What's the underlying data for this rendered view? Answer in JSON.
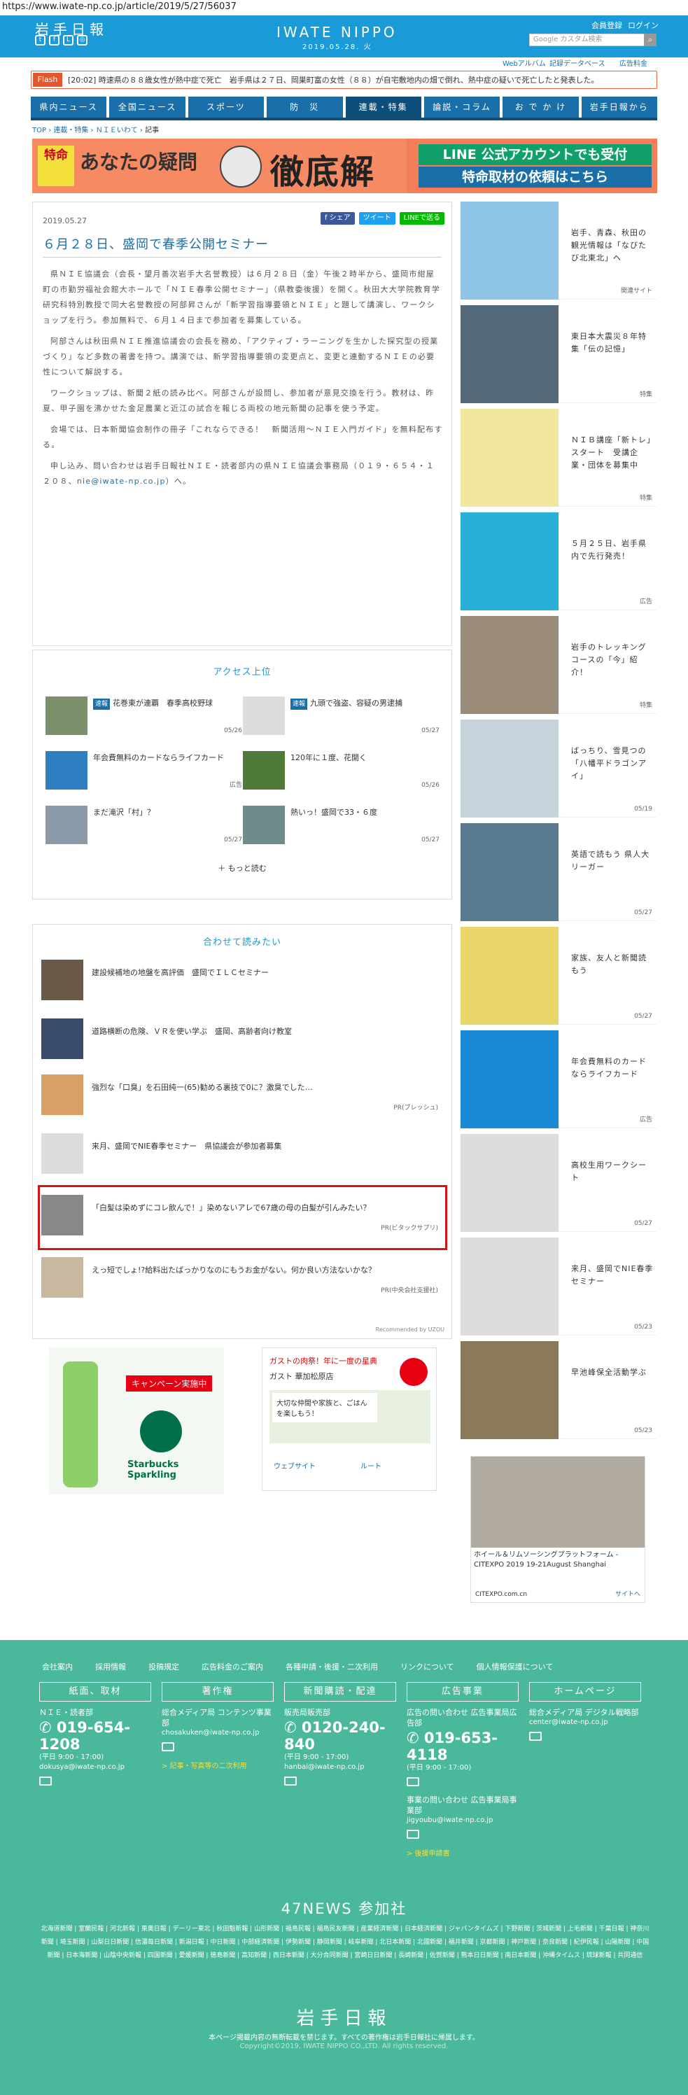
{
  "url": "https://www.iwate-np.co.jp/article/2019/5/27/56037",
  "header": {
    "logo_jp": "岩手日報",
    "brand": "IWATE NIPPO",
    "date": "2019.05.28. 火",
    "register": "会員登録",
    "login": "ログイン",
    "search_placeholder": "Google カスタム検索"
  },
  "sublinks": [
    "Webアルバム",
    "記録データベース",
    "広告料金"
  ],
  "flash": {
    "tag": "Flash",
    "text": "[20:02] 時速県の８８歳女性が熱中症で死亡　岩手県は２７日、岡巣町富の女性（８８）が自宅敷地内の畑で倒れ、熱中症の疑いで死亡したと発表した。"
  },
  "nav": [
    "県内ニュース",
    "全国ニュース",
    "スポーツ",
    "防　災",
    "連載・特集",
    "論説・コラム",
    "お で か け",
    "岩手日報から"
  ],
  "breadcrumb": [
    "TOP",
    "連載・特集",
    "ＮＩＥいわて",
    "記事"
  ],
  "banner": {
    "tokudo": "特命",
    "question": "あなたの疑問",
    "big": "徹底解明",
    "line1": "LINE 公式アカウントでも受付",
    "line2": "特命取材の依頼はこちら"
  },
  "article": {
    "date": "2019.05.27",
    "share": [
      "f シェア",
      "ツイート",
      "LINEで送る"
    ],
    "title": "６月２８日、盛岡で春季公開セミナー",
    "paragraphs": [
      "県ＮＩＥ協議会（会長・望月善次岩手大名誉教授）は６月２８日（金）午後２時半から、盛岡市紺屋町の市勤労福祉会館大ホールで「ＮＩＥ春季公開セミナー」（県教委後援）を開く。秋田大大学院教育学研究科特別教授で同大名誉教授の阿部昇さんが「新学習指導要領とＮＩＥ」と題して講演し、ワークショップを行う。参加無料で、６月１４日まで参加者を募集している。",
      "阿部さんは秋田県ＮＩＥ推進協議会の会長を務め、「アクティブ・ラーニングを生かした探究型の授業づくり」など多数の著書を持つ。講演では、新学習指導要領の変更点と、変更と連動するＮＩＥの必要性について解説する。",
      "ワークショップは、新聞２紙の読み比べ。阿部さんが設問し、参加者が意見交換を行う。教材は、昨夏、甲子園を沸かせた金足農業と近江の試合を報じる両校の地元新聞の記事を使う予定。",
      "会場では、日本新聞協会制作の冊子「これならできる！　新聞活用～ＮＩＥ入門ガイド」を無料配布する。"
    ],
    "contact": "申し込み、問い合わせは岩手日報社ＮＩＥ・読者部内の県ＮＩＥ協議会事務局（０１９・６５４・１２０８、",
    "email": "nie@iwate-np.co.jp",
    "contact_end": "）へ。"
  },
  "access": {
    "title": "アクセス上位",
    "items": [
      {
        "tag": "速報",
        "text": "花巻東が連覇　春季高校野球",
        "date": "05/26"
      },
      {
        "tag": "速報",
        "text": "九頭で強盗、容疑の男逮捕",
        "date": "05/27"
      },
      {
        "tag": "",
        "text": "年会費無料のカードならライフカード",
        "date": "広告"
      },
      {
        "tag": "",
        "text": "120年に１度、花開く",
        "date": "05/26"
      },
      {
        "tag": "",
        "text": "まだ滝沢「村」？",
        "date": "05/27"
      },
      {
        "tag": "",
        "text": "熱いっ！盛岡で33・６度",
        "date": "05/27"
      }
    ],
    "more": "もっと読む"
  },
  "related": {
    "title": "合わせて読みたい",
    "items": [
      {
        "text": "建設候補地の地盤を高評価　盛岡でＩＬＣセミナー",
        "pr": ""
      },
      {
        "text": "道路横断の危険、ＶＲを使い学ぶ　盛岡、高齢者向け教室",
        "pr": ""
      },
      {
        "text": "強烈な「口臭」を石田純一(65)勧める裏技で0に？激臭でした…",
        "pr": "PR(ブレッシュ)"
      },
      {
        "text": "来月、盛岡でNIE春季セミナー　県協議会が参加者募集",
        "pr": ""
      },
      {
        "text": "「白髪は染めずにコレ飲んで！」染めないアレで67歳の母の白髪が引んみたい？",
        "pr": "PR(ビタックサプリ)"
      },
      {
        "text": "えっ短でしょ!?給料出たばっかりなのにもうお金がない。何か良い方法ないかな？",
        "pr": "PR(中央会社支援社)"
      }
    ],
    "recommended": "Recommended by UZOU"
  },
  "ads": {
    "ad1_text": "キャンペーン実施中",
    "ad1_brand": "Starbucks Sparkling",
    "ad2_title": "ガストの肉祭！年に一度の星典",
    "ad2_sub": "ガスト 華加松原店",
    "ad2_body": "大切な仲間や家族と、ごはんを楽しもう！",
    "ad2_web": "ウェブサイト",
    "ad2_route": "ルート"
  },
  "side": [
    {
      "text": "岩手、青森、秋田の観光情報は「なびたび北東北」へ",
      "meta": "関連サイト"
    },
    {
      "text": "東日本大震災８年特集「伝の記憶」",
      "meta": "特集"
    },
    {
      "text": "ＮＩＢ講座「新トレ」スタート　受講企業・団体を募集中",
      "meta": "特集"
    },
    {
      "text": "５月２５日、岩手県内で先行発売！",
      "meta": "広告"
    },
    {
      "text": "岩手のトレッキングコースの「今」紹介！",
      "meta": "特集"
    },
    {
      "text": "ばっちり、雪見つの「八幡平ドラゴンアイ」",
      "meta": "05/19"
    },
    {
      "text": "英語で読もう 県人大リーガー",
      "meta": "05/27"
    },
    {
      "text": "家族、友人と新聞読もう",
      "meta": "05/27"
    },
    {
      "text": "年会費無料のカードならライフカード",
      "meta": "広告"
    },
    {
      "text": "高校生用ワークシート",
      "meta": "05/27"
    },
    {
      "text": "来月、盛岡でNIE春季セミナー",
      "meta": "05/23"
    },
    {
      "text": "早池峰保全活動学ぶ",
      "meta": "05/23"
    }
  ],
  "side_ad": {
    "text": "ホイール＆リムソーシングプラットフォーム -CITEXPO 2019 19-21August Shanghai",
    "brand": "CITEXPO.com.cn",
    "link": "サイトへ"
  },
  "footer": {
    "links": [
      "会社案内",
      "採用情報",
      "投稿規定",
      "広告料金のご案内",
      "各種申請・後援・二次利用",
      "リンクについて",
      "個人情報保護について"
    ],
    "cols": [
      {
        "head": "紙面、取材",
        "sub": "ＮＩＥ・読者部",
        "tel": "019-654-1208",
        "hours": "(平日 9:00 - 17:00)",
        "mail": "dokusya@iwate-np.co.jp",
        "extra": ""
      },
      {
        "head": "著作権",
        "sub": "総合メディア局 コンテンツ事業部",
        "tel": "",
        "hours": "",
        "mail": "chosakuken@iwate-np.co.jp",
        "extra": "> 記事・写真等の二次利用"
      },
      {
        "head": "新聞購読・配達",
        "sub": "販売局販売部",
        "tel": "0120-240-840",
        "hours": "(平日 9:00 - 17:00)",
        "mail": "hanbai@iwate-np.co.jp",
        "extra": ""
      },
      {
        "head": "広告事業",
        "sub": "広告の問い合わせ 広告事業局広告部",
        "tel": "019-653-4118",
        "hours": "(平日 9:00 - 17:00)",
        "mail": "jigyoubu@iwate-np.co.jp",
        "extra": "> 後援申請書",
        "sub2": "事業の問い合わせ 広告事業局事業部"
      },
      {
        "head": "ホームページ",
        "sub": "総合メディア局 デジタル戦略部",
        "tel": "",
        "hours": "",
        "mail": "center@iwate-np.co.jp",
        "extra": ""
      }
    ],
    "p47": "47NEWS 参加社",
    "papers": "北海道新聞 | 室蘭民報 | 河北新報 | 東奥日報 | デーリー東北 | 秋田魁新報 | 山形新聞 | 福島民報 | 福島民友新聞 | 産業経済新聞 | 日本経済新聞 | ジャパンタイムズ | 下野新聞 | 茨城新聞 | 上毛新聞 | 千葉日報 | 神奈川新聞 | 埼玉新聞 | 山梨日日新聞 | 信濃毎日新聞 | 新潟日報 | 中日新聞 | 中部経済新聞 | 伊勢新聞 | 静岡新聞 | 岐阜新聞 | 北日本新聞 | 北國新聞 | 福井新聞 | 京都新聞 | 神戸新聞 | 奈良新聞 | 紀伊民報 | 山陽新聞 | 中国新聞 | 日本海新聞 | 山陰中央新報 | 四国新聞 | 愛媛新聞 | 徳島新聞 | 高知新聞 | 西日本新聞 | 大分合同新聞 | 宮崎日日新聞 | 長崎新聞 | 佐賀新聞 | 熊本日日新聞 | 南日本新聞 | 沖縄タイムス | 琉球新報 | 共同通信",
    "logo": "岩手日報",
    "notice": "本ページ掲載内容の無断転載を禁じます。すべての著作権は岩手日報社に帰属します。",
    "copy": "Copyright©2019, IWATE NIPPO CO.,LTD. All rights reserved."
  },
  "colors": {
    "brand_blue": "#1a9ad6",
    "nav_blue": "#1a6fa8",
    "footer_green": "#4ab89b",
    "highlight_red": "#d81313"
  }
}
